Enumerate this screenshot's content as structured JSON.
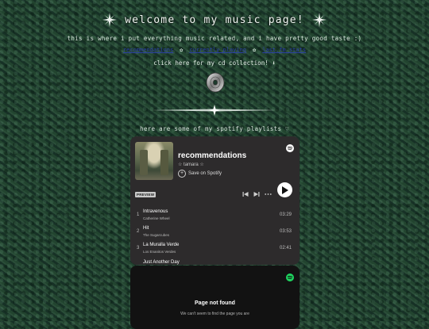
{
  "header": {
    "title": "welcome to my music page!",
    "subtitle": "this is where i put everything music related, and i have pretty good taste :)",
    "links": [
      "recommendations",
      "currently playing",
      "last.fm stats"
    ],
    "link_separator": "✿",
    "cd_link": "click here for my cd collection! ⬇",
    "playlists_text": "here are some of my spotify playlists ♡"
  },
  "spotify_embed": {
    "playlist_title": "recommendations",
    "owner": "☆ tamara ☆",
    "save_label": "Save on Spotify",
    "preview_label": "PREVIEW",
    "tracks": [
      {
        "num": "1",
        "name": "Intravenous",
        "artist": "Catherine Wheel",
        "duration": "03:29"
      },
      {
        "num": "2",
        "name": "Hit",
        "artist": "The Sugarcubes",
        "duration": "03:53"
      },
      {
        "num": "3",
        "name": "La Muralla Verde",
        "artist": "Los Enanitos Verdes",
        "duration": "02:41"
      },
      {
        "num": "",
        "name": "Just Another Day",
        "artist": "",
        "duration": ""
      }
    ]
  },
  "spotify_error": {
    "title": "Page not found",
    "subtitle": "We can't seem to find the page you are"
  },
  "colors": {
    "background": "#1c3a2c",
    "link": "#2b3fa8",
    "card": "#2d2b2c",
    "spotify_green": "#1ed760"
  },
  "icons": [
    "sparkle-icon",
    "cd-icon",
    "spotify-logo-icon",
    "plus-circle-icon",
    "previous-icon",
    "next-icon",
    "more-icon",
    "play-icon"
  ]
}
